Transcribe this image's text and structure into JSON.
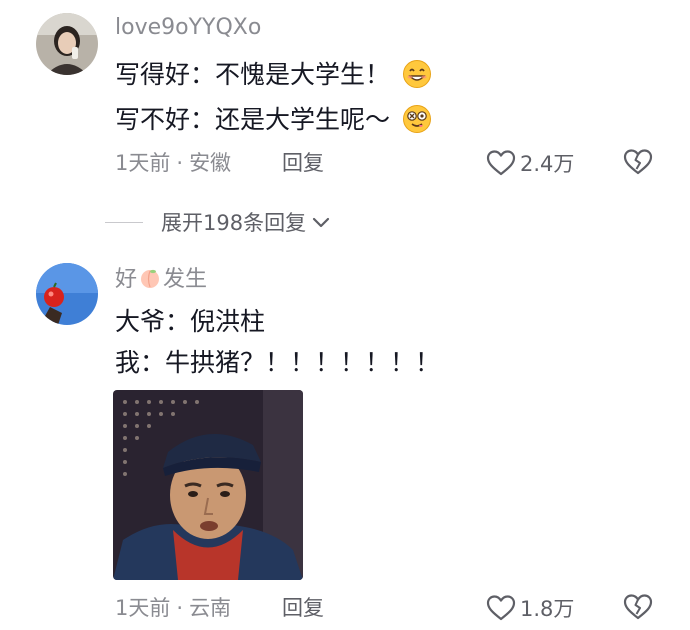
{
  "comments": [
    {
      "username": "love9oYYQXo",
      "lines": [
        "写得好：不愧是大学生！",
        "写不好：还是大学生呢～"
      ],
      "line_emojis": [
        "grinning-sweat-emoji",
        "dizzy-face-emoji"
      ],
      "time": "1天前",
      "location": "安徽",
      "reply_label": "回复",
      "like_count": "2.4万"
    },
    {
      "username_prefix": "好",
      "username_suffix": "发生",
      "username_emoji": "peach-emoji",
      "lines": [
        "大爷：倪洪柱",
        "我：牛拱猪？！！！！！！！"
      ],
      "image": "meme-image",
      "time": "1天前",
      "location": "云南",
      "reply_label": "回复",
      "like_count": "1.8万"
    }
  ],
  "expand_replies_label": "展开198条回复",
  "separator": "·",
  "icons": {
    "like": "heart-outline-icon",
    "dislike": "broken-heart-icon",
    "expand": "chevron-down-icon"
  }
}
